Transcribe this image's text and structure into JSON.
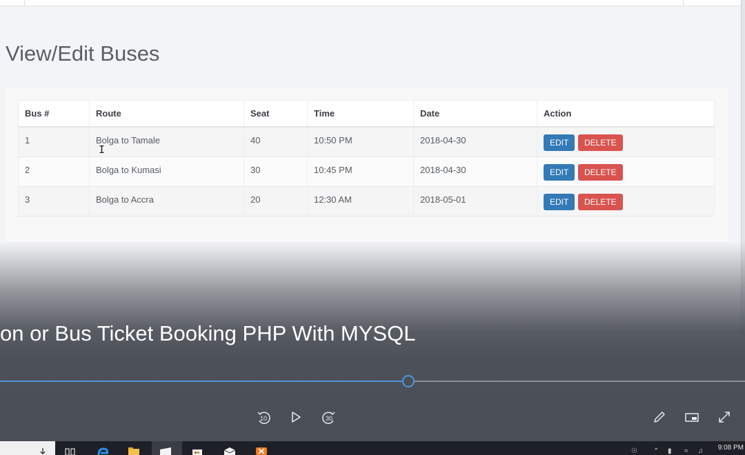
{
  "page": {
    "title": "View/Edit Buses"
  },
  "table": {
    "headers": [
      "Bus #",
      "Route",
      "Seat",
      "Time",
      "Date",
      "Action"
    ],
    "rows": [
      {
        "bus": "1",
        "route": "Bolga to Tamale",
        "seat": "40",
        "time": "10:50 PM",
        "date": "2018-04-30"
      },
      {
        "bus": "2",
        "route": "Bolga to Kumasi",
        "seat": "30",
        "time": "10:45 PM",
        "date": "2018-04-30"
      },
      {
        "bus": "3",
        "route": "Bolga to Accra",
        "seat": "20",
        "time": "12:30 AM",
        "date": "2018-05-01"
      }
    ],
    "edit_label": "EDIT",
    "delete_label": "DELETE"
  },
  "player": {
    "title": "on or Bus Ticket Booking PHP With MYSQL",
    "progress": 0.547,
    "rewind_label": "10",
    "forward_label": "30",
    "colors": {
      "progress": "#4e95e0",
      "edit": "#337ab7",
      "delete": "#d9534f"
    }
  },
  "taskbar": {
    "clock": "9:08 PM",
    "icons": [
      "task-view-icon",
      "edge-icon",
      "file-explorer-icon",
      "movies-tv-icon",
      "store-icon",
      "mail-icon",
      "xampp-icon"
    ]
  }
}
